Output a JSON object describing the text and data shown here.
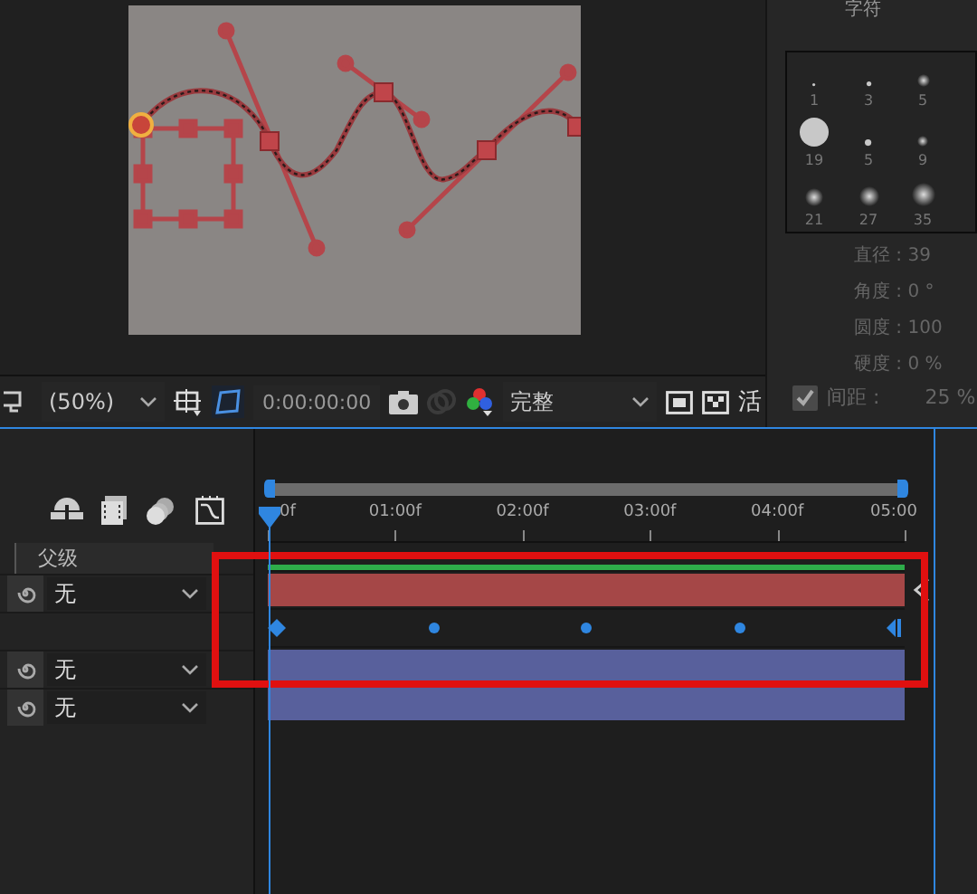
{
  "viewer_toolbar": {
    "zoom": "(50%)",
    "timecode": "0:00:00:00",
    "resolution": "完整",
    "cut_label": "活"
  },
  "character_panel": {
    "title": "字符",
    "brushes": [
      {
        "size": "1"
      },
      {
        "size": "3"
      },
      {
        "size": "5"
      },
      {
        "size": "19"
      },
      {
        "size": "5"
      },
      {
        "size": "9"
      },
      {
        "size": "21"
      },
      {
        "size": "27"
      },
      {
        "size": "35"
      }
    ],
    "properties": [
      {
        "label": "直径 : ",
        "value": "39"
      },
      {
        "label": "角度 : ",
        "value": "0 °"
      },
      {
        "label": "圆度 : ",
        "value": "100"
      },
      {
        "label": "硬度 : ",
        "value": "0 %"
      }
    ],
    "spacing": {
      "label": "间距 :",
      "value": "25 %",
      "checked": true
    }
  },
  "timeline": {
    "ruler": [
      "0f",
      "01:00f",
      "02:00f",
      "03:00f",
      "04:00f",
      "05:00"
    ],
    "parent_header": "父级",
    "rows": [
      {
        "kind": "layer",
        "parent": "无",
        "color": "#a54747"
      },
      {
        "kind": "keyframes",
        "keyframes": [
          {
            "kind": "start"
          },
          {
            "kind": "mid"
          },
          {
            "kind": "mid"
          },
          {
            "kind": "mid"
          },
          {
            "kind": "end"
          }
        ]
      },
      {
        "kind": "layer",
        "parent": "无",
        "color": "#58609c"
      },
      {
        "kind": "layer",
        "parent": "无",
        "color": "#58609c"
      }
    ]
  }
}
